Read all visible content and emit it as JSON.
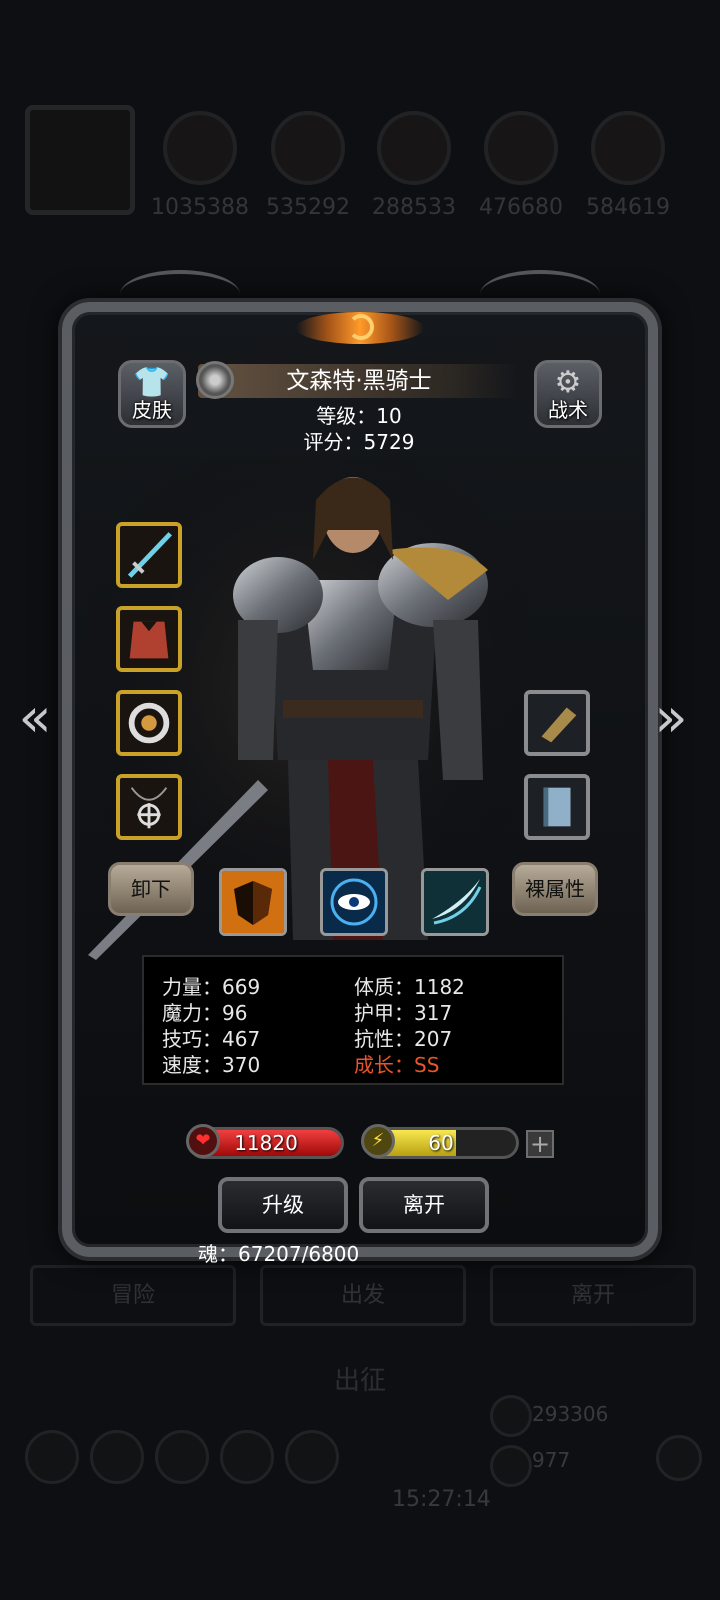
{
  "background": {
    "resources": [
      "1035388",
      "535292",
      "288533",
      "476680",
      "584619"
    ],
    "tabs": [
      "冒险",
      "出发",
      "离开"
    ],
    "title": "出征",
    "clock": "15:27:14",
    "gold": "293306",
    "gems": "977"
  },
  "panel": {
    "skin_label": "皮肤",
    "tactics_label": "战术",
    "hero_name": "文森特·黑骑士",
    "level_text": "等级：10",
    "score_text": "评分：5729",
    "unequip_label": "卸下",
    "base_attr_label": "裸属性"
  },
  "equipment": {
    "left": [
      "sword-icon",
      "armor-icon",
      "ring-icon",
      "amulet-icon"
    ],
    "right": [
      "gauntlet-icon",
      "book-icon"
    ]
  },
  "skills": [
    "shield-skill-icon",
    "eye-skill-icon",
    "slash-skill-icon"
  ],
  "stats": {
    "strength": "力量：669",
    "magic": "魔力：96",
    "skill": "技巧：467",
    "speed": "速度：370",
    "constitution": "体质：1182",
    "armor": "护甲：317",
    "resistance": "抗性：207",
    "growth": "成长：SS"
  },
  "bars": {
    "hp": "11820",
    "energy": "60",
    "energy_fill": 0.6
  },
  "buttons": {
    "upgrade": "升级",
    "leave": "离开"
  },
  "soul_text": "魂：67207/6800",
  "colors": {
    "hp": "#d01010",
    "energy": "#e8d020",
    "growth": "#e8542b",
    "equip_border": "#c9a227"
  }
}
